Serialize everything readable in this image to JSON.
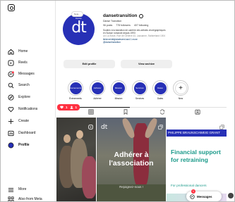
{
  "sidebar": {
    "items": [
      {
        "label": "Home",
        "icon": "home-icon"
      },
      {
        "label": "Reels",
        "icon": "reels-icon"
      },
      {
        "label": "Messages",
        "icon": "messages-icon"
      },
      {
        "label": "Search",
        "icon": "search-icon"
      },
      {
        "label": "Explore",
        "icon": "explore-icon"
      },
      {
        "label": "Notifications",
        "icon": "heart-icon"
      },
      {
        "label": "Create",
        "icon": "plus-icon"
      },
      {
        "label": "Dashboard",
        "icon": "dashboard-icon"
      },
      {
        "label": "Profile",
        "icon": "profile-icon"
      }
    ],
    "more": "More",
    "also_from_meta": "Also from Meta"
  },
  "profile": {
    "avatar_text": "dt",
    "avatar_small": "Danse",
    "note": "Note...",
    "username": "dansetransition",
    "fullname": "Danse Transition",
    "posts": "96 posts",
    "followers": "778 followers",
    "following": "407 following",
    "bio_line1": "Soutien à la transition de carrière des artistes chorégraphiques",
    "bio_line2": "en Suisse romande depuis 1993",
    "bio_line3": "c/o La Buvie, Rue de Genève 43, Lausanne, Switzerland 1004",
    "bio_link": "linktr.ee/dt/globalevent and 1 more",
    "bio_handle": "@dansetransition"
  },
  "buttons": {
    "edit_profile": "Edit profile",
    "view_archive": "View archive"
  },
  "highlights": [
    {
      "label": "Événements",
      "inner": "Événements"
    },
    {
      "label": "Adhérer",
      "inner": "Adhérer"
    },
    {
      "label": "Mission",
      "inner": "Mission"
    },
    {
      "label": "Services",
      "inner": "Services"
    },
    {
      "label": "Dates",
      "inner": "Dates"
    },
    {
      "label": "New",
      "inner": "+"
    }
  ],
  "notifications": {
    "hearts": "1",
    "people": "1"
  },
  "posts": {
    "post2_title": "Adhérer à l'association",
    "post2_sub": "Rejoignez-nous !",
    "post2_logo": "dt",
    "post3_ribbon": "PHILIPPE BRAUNSCHWEIG GRANT",
    "post3_title": "Financial support for retraining",
    "post3_sub": "For professional dancers"
  },
  "messages": {
    "label": "Messages",
    "badge": "1"
  },
  "colors": {
    "brand_blue": "#2730b6",
    "alert_red": "#ff3040",
    "teal": "#1b9a8a"
  }
}
